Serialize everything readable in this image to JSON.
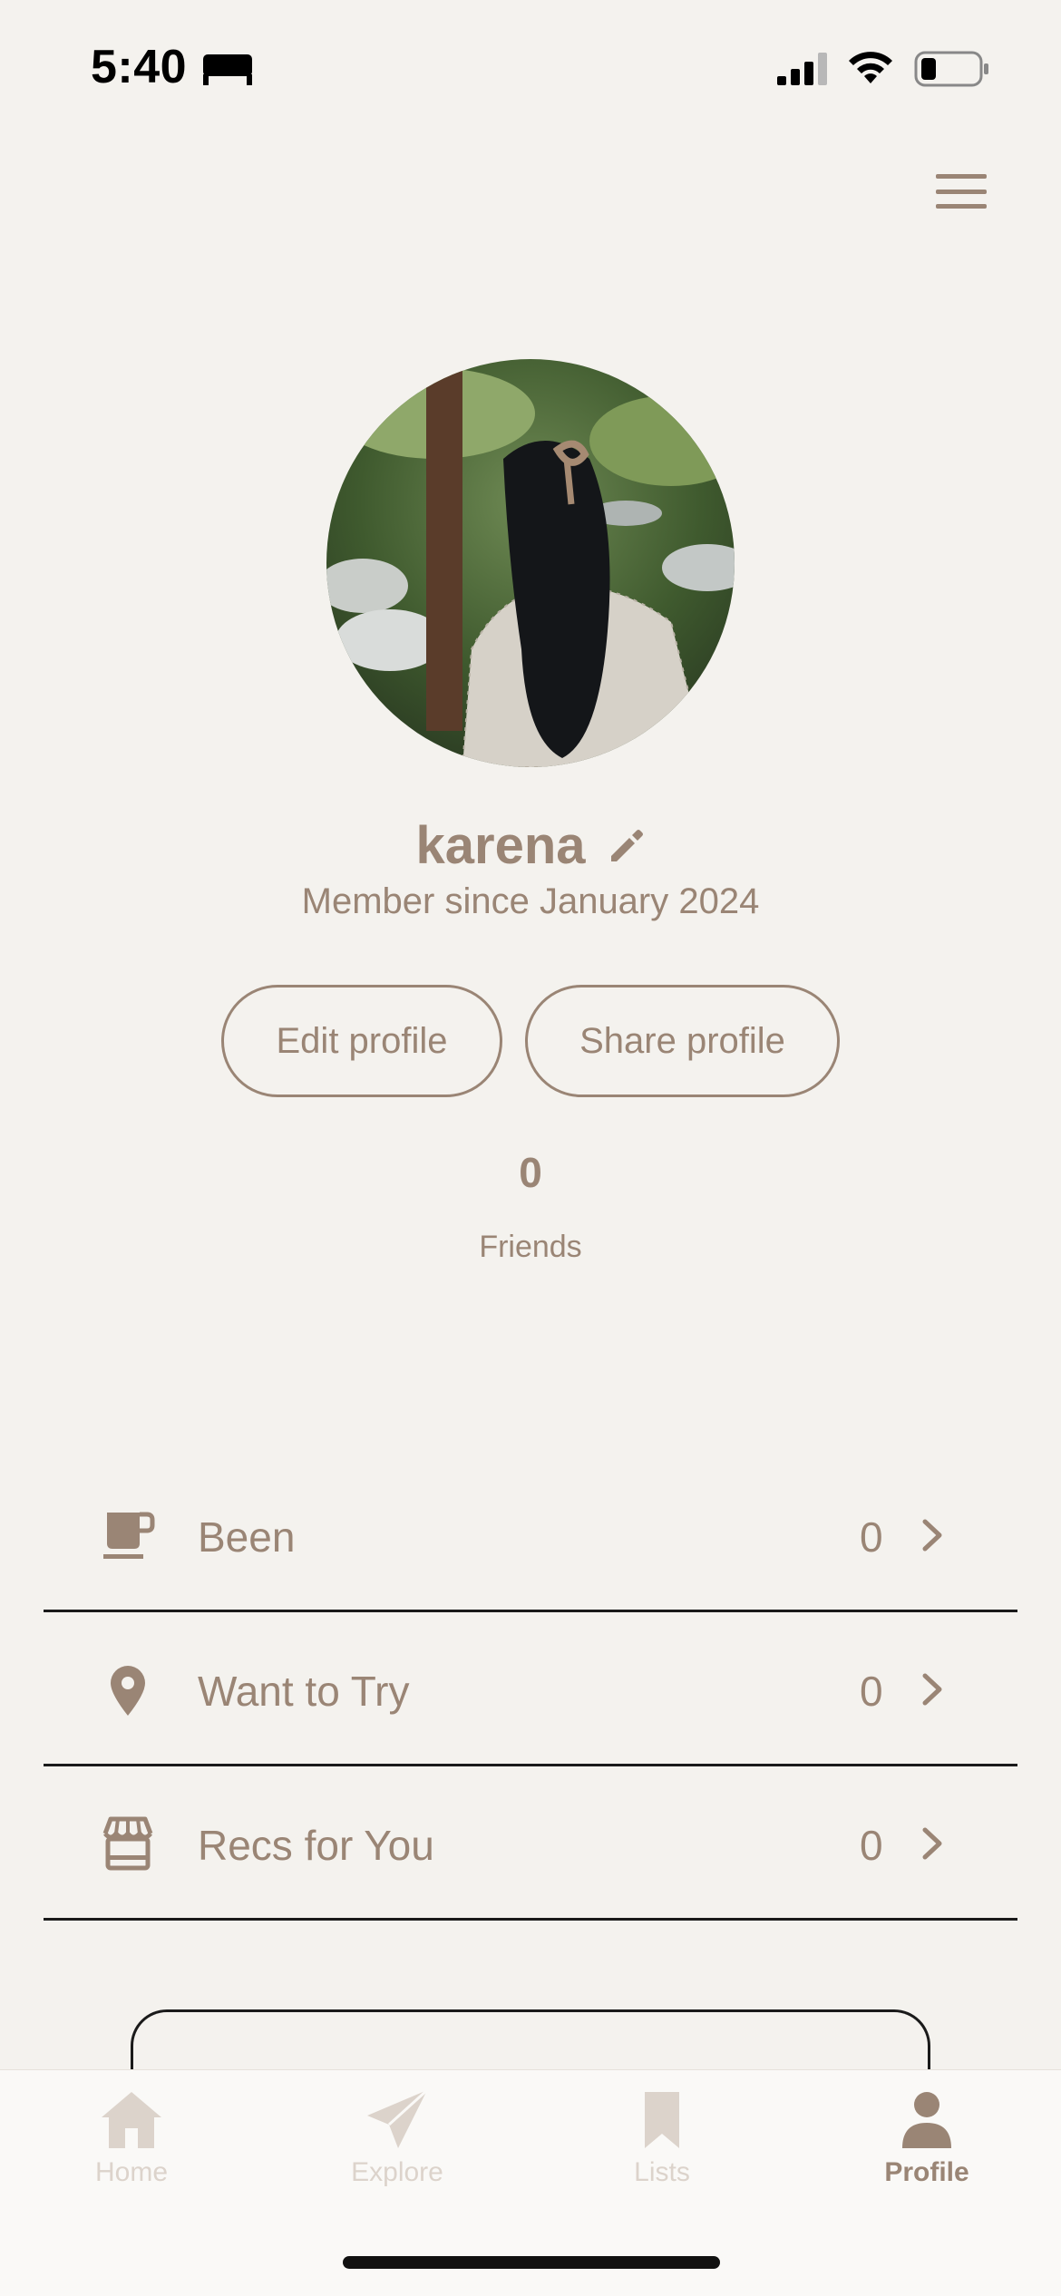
{
  "status_bar": {
    "time": "5:40",
    "icons": [
      "bed-icon",
      "cellular-signal-icon",
      "wifi-icon",
      "battery-icon"
    ]
  },
  "header": {
    "menu_icon": "hamburger-menu-icon"
  },
  "profile": {
    "username": "karena",
    "member_since": "Member since January 2024",
    "edit_profile_label": "Edit profile",
    "share_profile_label": "Share profile",
    "friends_count": "0",
    "friends_label": "Friends"
  },
  "list_rows": [
    {
      "icon": "coffee-cup-icon",
      "label": "Been",
      "count": "0"
    },
    {
      "icon": "map-pin-icon",
      "label": "Want to Try",
      "count": "0"
    },
    {
      "icon": "storefront-icon",
      "label": "Recs for You",
      "count": "0"
    }
  ],
  "tab_bar": {
    "tabs": [
      {
        "icon": "home-icon",
        "label": "Home",
        "active": false
      },
      {
        "icon": "paper-plane-icon",
        "label": "Explore",
        "active": false
      },
      {
        "icon": "bookmark-icon",
        "label": "Lists",
        "active": false
      },
      {
        "icon": "person-icon",
        "label": "Profile",
        "active": true
      }
    ]
  },
  "colors": {
    "background": "#f4f2ee",
    "accent": "#9a8575",
    "inactive_tab": "#dcd3cb",
    "divider": "#1a1a1a"
  }
}
